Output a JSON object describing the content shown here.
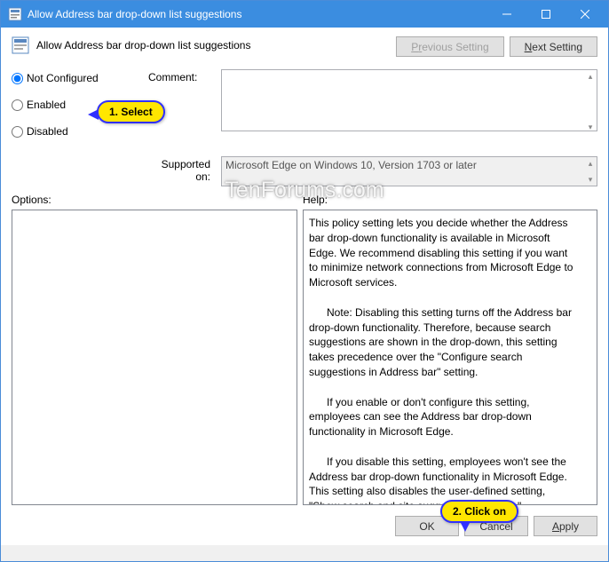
{
  "titlebar": {
    "title": "Allow Address bar drop-down list suggestions"
  },
  "subheader": {
    "title": "Allow Address bar drop-down list suggestions",
    "prev_label_pre": "P",
    "prev_label_u": "r",
    "prev_label_post": "evious Setting",
    "next_label_pre": "",
    "next_label_u": "N",
    "next_label_post": "ext Setting"
  },
  "radios": {
    "notconfigured_label": "Not Configured",
    "enabled_u": "E",
    "enabled_post": "nabled",
    "disabled_u": "D",
    "disabled_post": "isabled"
  },
  "labels": {
    "comment_pre": "",
    "comment_u": "C",
    "comment_post": "omment:",
    "supported": "Supported on:",
    "options_u": "O",
    "options_post": "ptions:",
    "help_u": "H",
    "help_post": "elp:"
  },
  "supported_on": "Microsoft Edge on Windows 10, Version 1703 or later",
  "help_text": "This policy setting lets you decide whether the Address bar drop-down functionality is available in Microsoft Edge. We recommend disabling this setting if you want to minimize network connections from Microsoft Edge to Microsoft services.\n\n      Note: Disabling this setting turns off the Address bar drop-down functionality. Therefore, because search suggestions are shown in the drop-down, this setting takes precedence over the \"Configure search suggestions in Address bar\" setting.\n\n      If you enable or don't configure this setting, employees can see the Address bar drop-down functionality in Microsoft Edge.\n\n      If you disable this setting, employees won't see the Address bar drop-down functionality in Microsoft Edge. This setting also disables the user-defined setting, \"Show search and site suggestions as I type\".",
  "buttons": {
    "ok": "OK",
    "cancel": "Cancel",
    "apply_u": "A",
    "apply_post": "pply"
  },
  "callouts": {
    "select": "1. Select",
    "click": "2. Click on"
  },
  "watermark": "TenForums.com"
}
